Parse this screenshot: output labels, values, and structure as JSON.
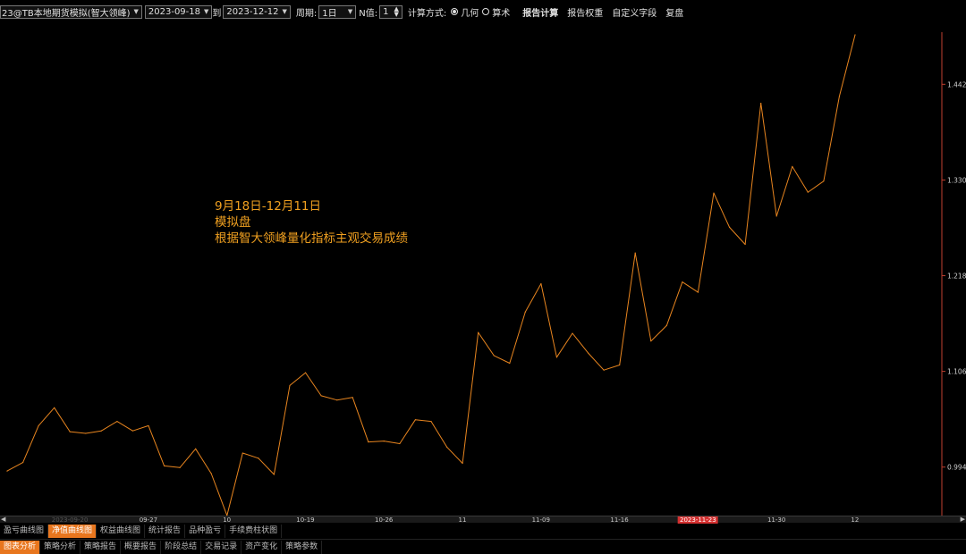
{
  "toolbar": {
    "account": "23@TB本地期货模拟(智大领峰)",
    "start_date": "2023-09-18",
    "to_label": "到",
    "end_date": "2023-12-12",
    "period_label": "周期:",
    "period_value": "1日",
    "n_label": "N值:",
    "n_value": "1",
    "calc_label": "计算方式:",
    "calc_options": [
      "几何",
      "算术"
    ],
    "calc_selected": "几何",
    "buttons": [
      "报告计算",
      "报告权重",
      "自定义字段",
      "复盘"
    ]
  },
  "annotation": {
    "line1": "9月18日-12月11日",
    "line2": "模拟盘",
    "line3": "根据智大领峰量化指标主观交易成绩"
  },
  "chart_data": {
    "type": "line",
    "title": "",
    "xlabel": "",
    "ylabel": "",
    "series": [
      {
        "values": [
          0.99,
          1.0,
          1.043,
          1.064,
          1.036,
          1.034,
          1.037,
          1.048,
          1.037,
          1.043,
          0.996,
          0.994,
          1.016,
          0.987,
          0.938,
          1.011,
          1.005,
          0.986,
          1.09,
          1.105,
          1.078,
          1.073,
          1.076,
          1.024,
          1.025,
          1.022,
          1.05,
          1.048,
          1.018,
          0.999,
          1.152,
          1.125,
          1.116,
          1.176,
          1.209,
          1.123,
          1.151,
          1.128,
          1.108,
          1.114,
          1.245,
          1.142,
          1.16,
          1.211,
          1.199,
          1.315,
          1.275,
          1.255,
          1.42,
          1.288,
          1.346,
          1.316,
          1.329,
          1.428,
          1.5
        ],
        "color": "#e8851f"
      }
    ],
    "y_ticks": [
      "1.4422",
      "1.3303",
      "1.2184",
      "1.1065",
      "0.9946"
    ],
    "ylim": [
      0.94,
      1.5
    ],
    "x_ticks": [
      {
        "label": "2023-09-20",
        "index": 2
      },
      {
        "label": "09-27",
        "index": 7
      },
      {
        "label": "10",
        "index": 12
      },
      {
        "label": "10-19",
        "index": 17
      },
      {
        "label": "10-26",
        "index": 22
      },
      {
        "label": "11",
        "index": 27
      },
      {
        "label": "11-09",
        "index": 32
      },
      {
        "label": "11-16",
        "index": 37
      },
      {
        "label": "2023-11-23",
        "index": 42
      },
      {
        "label": "11-30",
        "index": 47
      },
      {
        "label": "12",
        "index": 52
      }
    ],
    "grid": false,
    "legend": "none"
  },
  "tabs_row1": {
    "items": [
      "盈亏曲线图",
      "净值曲线图",
      "权益曲线图",
      "统计报告",
      "品种盈亏",
      "手续费柱状图"
    ],
    "active": "净值曲线图"
  },
  "tabs_row2": {
    "items": [
      "图表分析",
      "策略分析",
      "策略报告",
      "概要报告",
      "阶段总结",
      "交易记录",
      "资产变化",
      "策略参数"
    ],
    "active": "图表分析"
  },
  "colors": {
    "line": "#e8851f",
    "accent": "#e8761e",
    "annotation": "#f0a020",
    "axis": "#c04030"
  }
}
